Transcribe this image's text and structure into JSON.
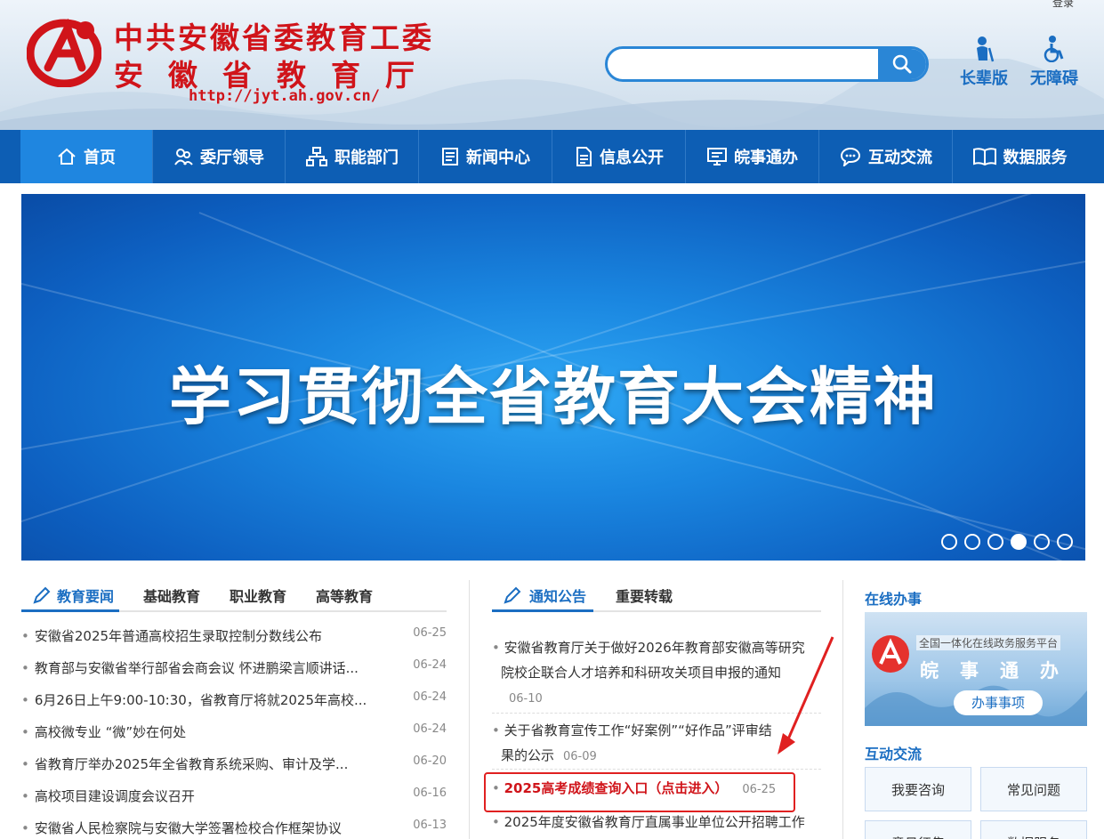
{
  "header": {
    "title_line1": "中共安徽省委教育工委",
    "title_line2": "安徽省教育厅",
    "url": "http://jyt.ah.gov.cn/",
    "search_placeholder": "",
    "tools": [
      {
        "label": "长辈版",
        "icon": "elder-icon"
      },
      {
        "label": "无障碍",
        "icon": "wheelchair-icon"
      }
    ],
    "top_cut_text": "登录"
  },
  "nav": [
    {
      "label": "首页",
      "icon": "home-icon"
    },
    {
      "label": "委厅领导",
      "icon": "leaders-icon"
    },
    {
      "label": "职能部门",
      "icon": "org-chart-icon"
    },
    {
      "label": "新闻中心",
      "icon": "news-icon"
    },
    {
      "label": "信息公开",
      "icon": "document-icon"
    },
    {
      "label": "皖事通办",
      "icon": "monitor-icon"
    },
    {
      "label": "互动交流",
      "icon": "chat-icon"
    },
    {
      "label": "数据服务",
      "icon": "book-icon"
    }
  ],
  "banner": {
    "text": "学习贯彻全省教育大会精神",
    "slide_count": 6,
    "active_slide": 4
  },
  "news": {
    "tabs": [
      "教育要闻",
      "基础教育",
      "职业教育",
      "高等教育"
    ],
    "items": [
      {
        "title": "安徽省2025年普通高校招生录取控制分数线公布",
        "date": "06-25"
      },
      {
        "title": "教育部与安徽省举行部省会商会议 怀进鹏梁言顺讲话...",
        "date": "06-24"
      },
      {
        "title": "6月26日上午9:00-10:30，省教育厅将就2025年高校...",
        "date": "06-24"
      },
      {
        "title": "高校微专业 “微”妙在何处",
        "date": "06-24"
      },
      {
        "title": "省教育厅举办2025年全省教育系统采购、审计及学...",
        "date": "06-20"
      },
      {
        "title": "高校项目建设调度会议召开",
        "date": "06-16"
      },
      {
        "title": "安徽省人民检察院与安徽大学签署检校合作框架协议",
        "date": "06-13"
      }
    ]
  },
  "notices": {
    "tabs": [
      "通知公告",
      "重要转载"
    ],
    "items": [
      {
        "title_l1": "安徽省教育厅关于做好2026年教育部安徽高等研究",
        "title_l2": "院校企联合人才培养和科研攻关项目申报的通知",
        "title_l3": "",
        "date": "06-10"
      },
      {
        "title_l1": "关于省教育宣传工作“好案例”“好作品”评审结",
        "title_l2": "果的公示",
        "date": "06-09"
      },
      {
        "title_l1": "2025高考成绩查询入口（点击进入）",
        "date": "06-25"
      },
      {
        "title_l1": "2025年度安徽省教育厅直属事业单位公开招聘工作",
        "date": ""
      }
    ]
  },
  "sidebar": {
    "online_title": "在线办事",
    "service_platform": "全国一体化在线政务服务平台",
    "service_name": "皖事通办",
    "service_button": "办事事项",
    "interact_title": "互动交流",
    "buttons": [
      "我要咨询",
      "常见问题",
      "意见征集",
      "数据服务"
    ]
  },
  "colors": {
    "brand_red": "#d0141a",
    "nav_blue": "#0d5eb4",
    "accent_blue": "#1b6ec2"
  }
}
